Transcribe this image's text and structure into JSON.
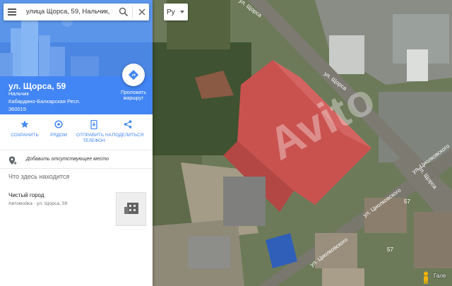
{
  "search": {
    "query": "улица Щорса, 59, Нальчик, Каба"
  },
  "language": {
    "selected": "Ру"
  },
  "place": {
    "name": "ул. Щорса, 59",
    "address_lines": [
      "Нальчик",
      "Кабардино-Балкарская Респ.",
      "360015"
    ],
    "route_label": "Проложить маршрут"
  },
  "actions": [
    {
      "label": "СОХРАНИТЬ",
      "icon": "star-icon"
    },
    {
      "label": "РЯДОМ",
      "icon": "nearby-icon"
    },
    {
      "label": "ОТПРАВИТЬ НА ТЕЛЕФОН",
      "icon": "send-to-phone-icon"
    },
    {
      "label": "ПОДЕЛИТЬСЯ",
      "icon": "share-icon"
    }
  ],
  "add_place": {
    "label": "Добавить отсутствующее место"
  },
  "section": {
    "title": "Что здесь находится"
  },
  "nearby": {
    "name": "Чистый город",
    "subtitle": "Автомойка · ул. Щорса, 59"
  },
  "map": {
    "streets": [
      "ул. Щорса",
      "ул. Щорса",
      "ул. Щорса",
      "ул. Циолковского",
      "ул. Циолковского",
      "ул. Циолковского"
    ],
    "building_numbers": [
      "57",
      "57"
    ],
    "watermark": "Avito",
    "attribution": "Гале"
  },
  "colors": {
    "accent": "#4285f4",
    "roof": "#c9524f",
    "roof_blue": "#2f5fb8"
  }
}
